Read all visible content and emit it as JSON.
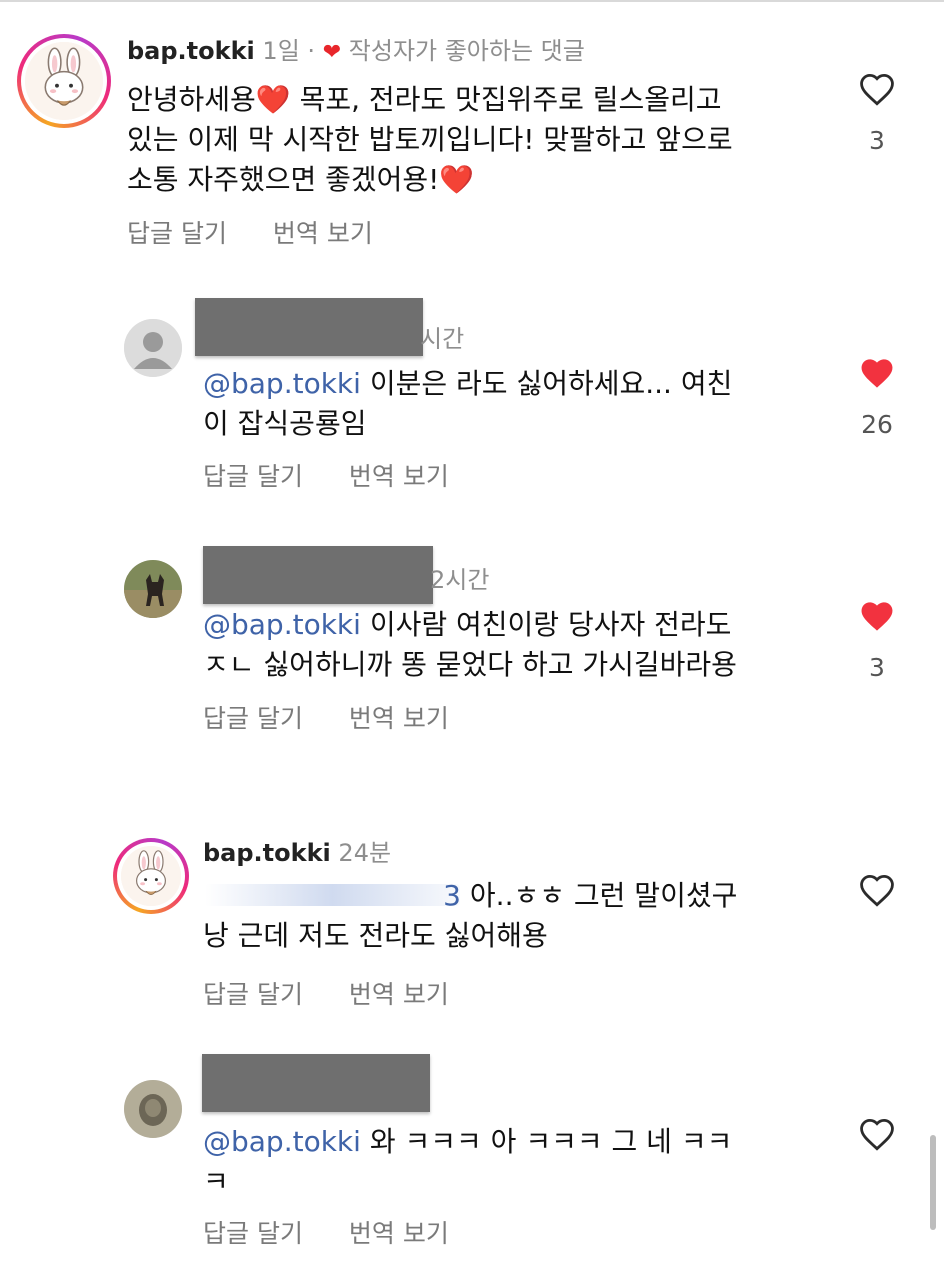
{
  "comments": [
    {
      "username": "bap.tokki",
      "time": "1일",
      "separator": "·",
      "author_liked_label": "작성자가 좋아하는 댓글",
      "text_lines": [
        "안녕하세용❤️ 목포, 전라도 맛집위주로 릴스올리고",
        "있는 이제 막 시작한 밥토끼입니다! 맞팔하고 앞으로",
        "소통 자주했으면 좋겠어용!❤️"
      ],
      "reply_label": "답글 달기",
      "translate_label": "번역 보기",
      "like_count": "3",
      "liked": false
    },
    {
      "time": "시간",
      "mention": "@bap.tokki",
      "text_lines": [
        "이분은 라도 싫어하세요... 여친",
        "이 잡식공룡임"
      ],
      "reply_label": "답글 달기",
      "translate_label": "번역 보기",
      "like_count": "26",
      "liked": true
    },
    {
      "time": "2시간",
      "mention": "@bap.tokki",
      "text_lines": [
        "이사람 여친이랑 당사자 전라도",
        "ㅈㄴ 싫어하니까 똥 묻었다 하고 가시길바라용"
      ],
      "reply_label": "답글 달기",
      "translate_label": "번역 보기",
      "like_count": "3",
      "liked": true
    },
    {
      "username": "bap.tokki",
      "time": "24분",
      "partial_mention_tail": "3",
      "text_lines": [
        "아..ㅎㅎ 그런 말이셨구",
        "낭 근데 저도 전라도 싫어해용"
      ],
      "reply_label": "답글 달기",
      "translate_label": "번역 보기",
      "liked": false
    },
    {
      "mention": "@bap.tokki",
      "text_lines": [
        "와 ㅋㅋㅋ 아 ㅋㅋㅋ 그 네 ㅋㅋ",
        "ㅋ"
      ],
      "reply_label": "답글 달기",
      "translate_label": "번역 보기",
      "liked": false
    }
  ],
  "colors": {
    "heart_filled": "#f2323f",
    "mention": "#3f63a8",
    "meta_gray": "#8e8e8e"
  },
  "icons": {
    "like_outline": "heart-outline-icon",
    "like_filled": "heart-filled-icon",
    "author_like": "heart-small-icon",
    "default_avatar": "person-silhouette-icon"
  }
}
